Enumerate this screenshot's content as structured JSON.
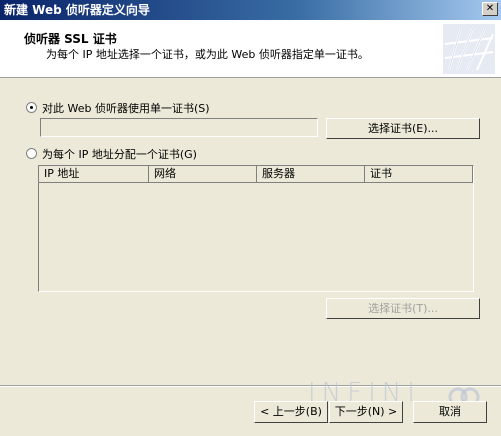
{
  "window": {
    "title": "新建 Web 侦听器定义向导",
    "close_glyph": "✕"
  },
  "header": {
    "title": "侦听器 SSL 证书",
    "subtitle": "为每个 IP 地址选择一个证书，或为此 Web 侦听器指定单一证书。"
  },
  "option_single": {
    "label": "对此 Web 侦听器使用单一证书(S)",
    "selected": true,
    "certificate_value": "",
    "select_button": "选择证书(E)..."
  },
  "option_per_ip": {
    "label": "为每个 IP 地址分配一个证书(G)",
    "selected": false,
    "columns": [
      "IP 地址",
      "网络",
      "服务器",
      "证书"
    ],
    "rows": [],
    "select_button": "选择证书(T)..."
  },
  "footer": {
    "back_button": "< 上一步(B)",
    "next_button": "下一步(N) >",
    "cancel_button": "取消"
  },
  "watermark": "INFINI"
}
